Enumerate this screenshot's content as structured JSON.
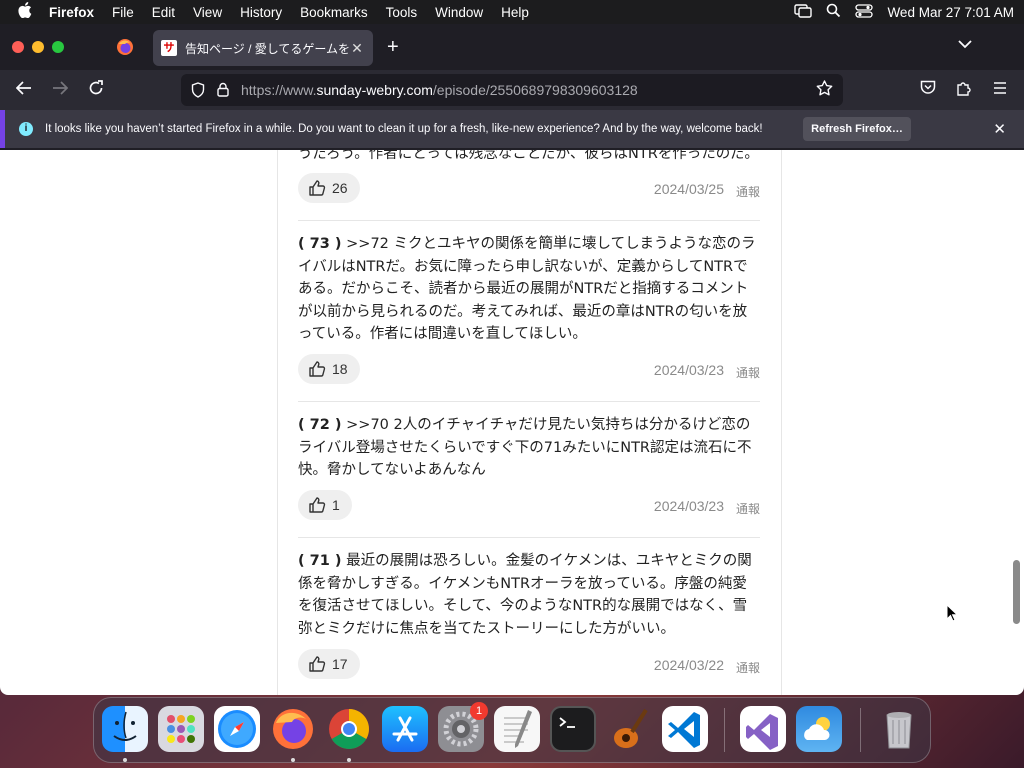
{
  "menubar": {
    "app": "Firefox",
    "items": [
      "File",
      "Edit",
      "View",
      "History",
      "Bookmarks",
      "Tools",
      "Window",
      "Help"
    ],
    "clock": "Wed Mar 27  7:01 AM"
  },
  "tab": {
    "favicon": "サ",
    "title": "告知ページ / 愛してるゲームを終",
    "close": "✕",
    "new": "+"
  },
  "url": {
    "scheme": "https://www.",
    "host": "sunday-webry.com",
    "path": "/episode/2550689798309603128"
  },
  "infobar": {
    "message": "It looks like you haven’t started Firefox in a while. Do you want to clean it up for a fresh, like-new experience? And by the way, welcome back!",
    "button": "Refresh Firefox…",
    "close": "✕"
  },
  "comments": [
    {
      "text": "うだろう。作者にとっては残念なことだが、彼らはNTRを作ったのだ。",
      "likes": "26",
      "date": "2024/03/25",
      "report": "通報"
    },
    {
      "number": "( 73 )",
      "text": " >>72 ミクとユキヤの関係を簡単に壊してしまうような恋のライバルはNTRだ。お気に障ったら申し訳ないが、定義からしてNTRである。だからこそ、読者から最近の展開がNTRだと指摘するコメントが以前から見られるのだ。考えてみれば、最近の章はNTRの匂いを放っている。作者には間違いを直してほしい。",
      "likes": "18",
      "date": "2024/03/23",
      "report": "通報"
    },
    {
      "number": "( 72 )",
      "text": " >>70 2人のイチャイチャだけ見たい気持ちは分かるけど恋のライバル登場させたくらいですぐ下の71みたいにNTR認定は流石に不快。脅かしてないよあんなん",
      "likes": "1",
      "date": "2024/03/23",
      "report": "通報"
    },
    {
      "number": "( 71 )",
      "text": " 最近の展開は恐ろしい。金髪のイケメンは、ユキヤとミクの関係を脅かしすぎる。イケメンもNTRオーラを放っている。序盤の純愛を復活させてほしい。そして、今のようなNTR的な展開ではなく、雪弥とミクだけに焦点を当てたストーリーにした方がいい。",
      "likes": "17",
      "date": "2024/03/22",
      "report": "通報"
    }
  ],
  "dock": {
    "badge": "1",
    "apps": [
      "finder-icon",
      "launchpad-icon",
      "safari-icon",
      "firefox-icon",
      "chrome-icon",
      "app-store-icon",
      "system-settings-icon",
      "textedit-icon",
      "terminal-icon",
      "garageband-icon",
      "vscode-icon",
      "visual-studio-icon",
      "weather-icon",
      "trash-icon"
    ]
  }
}
